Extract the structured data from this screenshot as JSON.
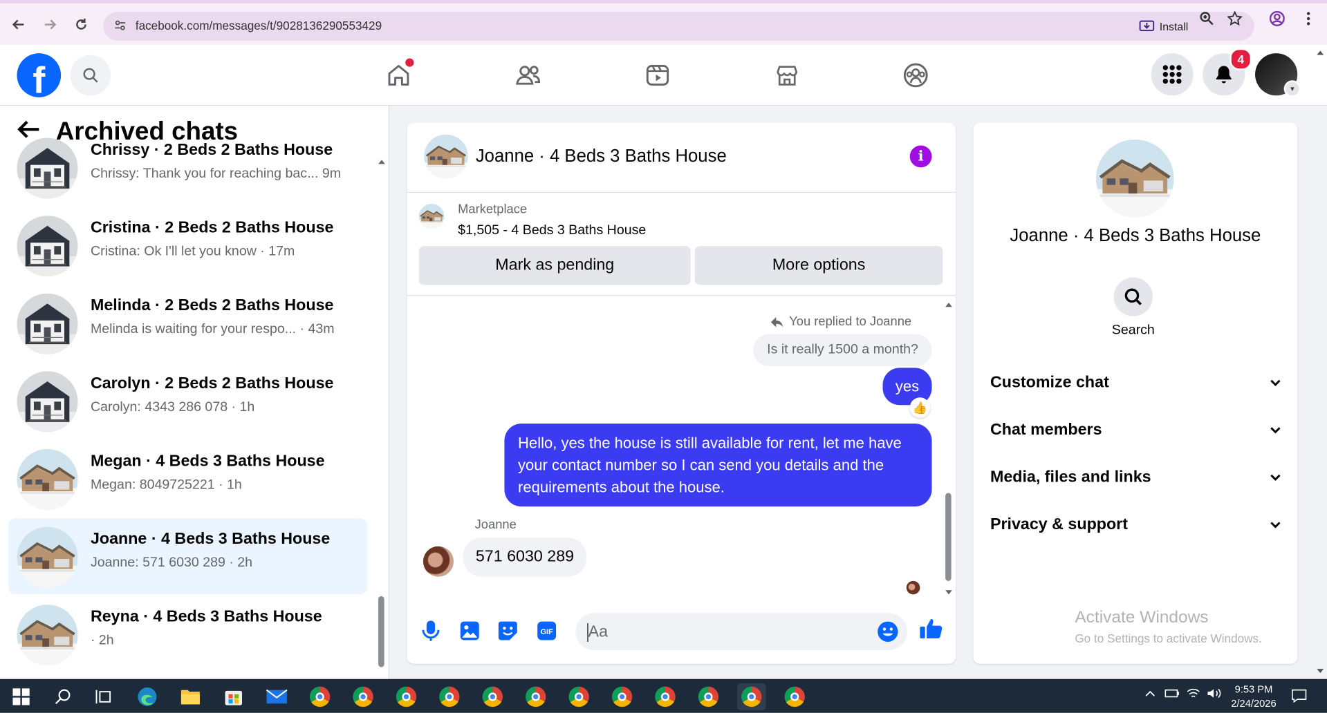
{
  "browser": {
    "url": "facebook.com/messages/t/9028136290553429",
    "install_label": "Install"
  },
  "header": {
    "logo_letter": "f",
    "notifications_count": "4"
  },
  "sidebar": {
    "title": "Archived chats",
    "chats": [
      {
        "name": "Chrissy · 2 Beds 2 Baths House",
        "preview": "Chrissy: Thank you for reaching bac... 9m",
        "thumb": "house-dark"
      },
      {
        "name": "Cristina · 2 Beds 2 Baths House",
        "preview": "Cristina: Ok I'll let you know · 17m",
        "thumb": "house-dark"
      },
      {
        "name": "Melinda · 2 Beds 2 Baths House",
        "preview": "Melinda is waiting for your respo... · 43m",
        "thumb": "house-dark"
      },
      {
        "name": "Carolyn · 2 Beds 2 Baths House",
        "preview": "Carolyn: 4343 286 078 · 1h",
        "thumb": "house-dark"
      },
      {
        "name": "Megan · 4 Beds 3 Baths House",
        "preview": "Megan: 8049725221 · 1h",
        "thumb": "house-snow"
      },
      {
        "name": "Joanne · 4 Beds 3 Baths House",
        "preview": "Joanne: 571 6030 289 · 2h",
        "thumb": "house-snow",
        "active": true
      },
      {
        "name": "Reyna · 4 Beds 3 Baths House",
        "preview": "· 2h",
        "thumb": "house-snow"
      }
    ]
  },
  "conversation": {
    "title": "Joanne · 4 Beds 3 Baths House",
    "marketplace_label": "Marketplace",
    "listing": "$1,505 - 4 Beds 3 Baths House",
    "mark_pending_label": "Mark as pending",
    "more_options_label": "More options",
    "replied_note": "You replied to Joanne",
    "quoted_message": "Is it really 1500 a month?",
    "reply_message": "yes",
    "long_message": "Hello, yes the house is still available for rent, let me have your contact number so I can send you details and the requirements about the house.",
    "sender_name": "Joanne",
    "incoming_message": "571 6030 289",
    "composer_placeholder": "Aa",
    "reaction": "👍"
  },
  "details": {
    "title": "Joanne · 4 Beds 3 Baths House",
    "search_label": "Search",
    "sections": [
      "Customize chat",
      "Chat members",
      "Media, files and links",
      "Privacy & support"
    ],
    "watermark_title": "Activate Windows",
    "watermark_sub": "Go to Settings to activate Windows."
  },
  "taskbar": {
    "time": "9:53 PM",
    "date": "2/24/2026"
  },
  "colors": {
    "fb_blue": "#0866ff",
    "messenger_purple": "#3b3bf2",
    "info_purple": "#a10ee3",
    "badge_red": "#e41e3f",
    "active_chat_bg": "#ebf5ff"
  }
}
